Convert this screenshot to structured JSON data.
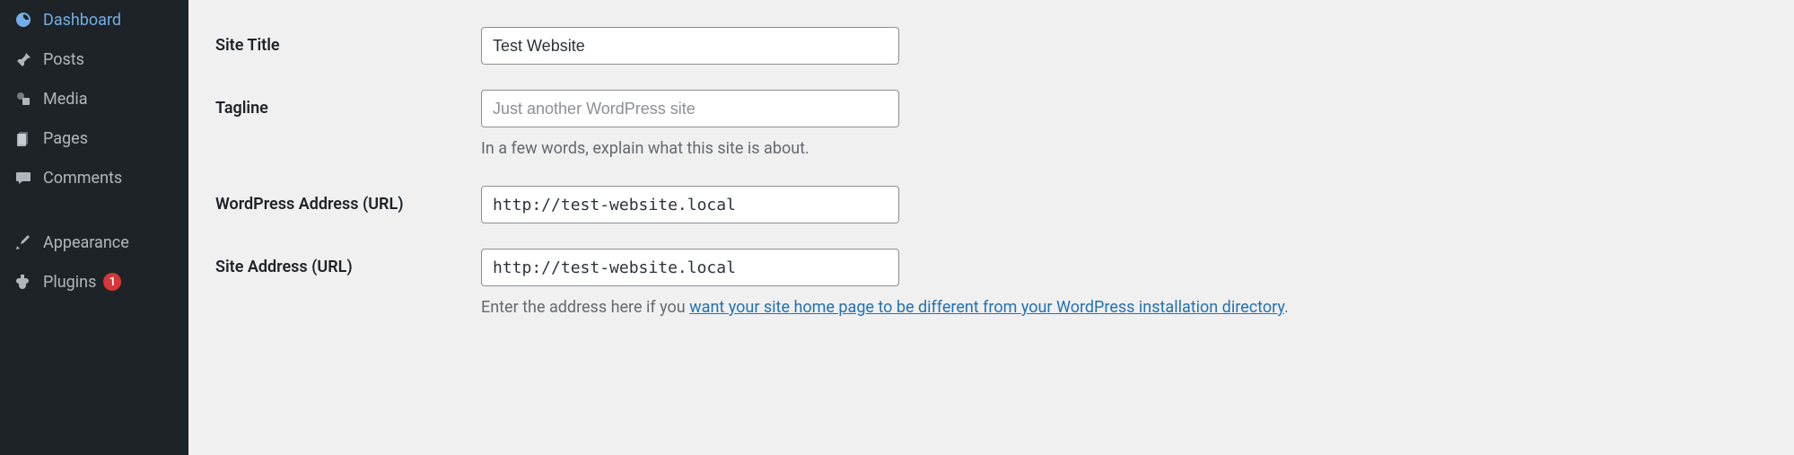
{
  "sidebar": {
    "items": [
      {
        "label": "Dashboard",
        "icon": "dashboard"
      },
      {
        "label": "Posts",
        "icon": "pin"
      },
      {
        "label": "Media",
        "icon": "media"
      },
      {
        "label": "Pages",
        "icon": "pages"
      },
      {
        "label": "Comments",
        "icon": "comments"
      },
      {
        "label": "Appearance",
        "icon": "appearance"
      },
      {
        "label": "Plugins",
        "icon": "plugins",
        "badge": "1"
      }
    ]
  },
  "form": {
    "siteTitle": {
      "label": "Site Title",
      "value": "Test Website"
    },
    "tagline": {
      "label": "Tagline",
      "placeholder": "Just another WordPress site",
      "help": "In a few words, explain what this site is about."
    },
    "wpAddress": {
      "label": "WordPress Address (URL)",
      "value": "http://test-website.local"
    },
    "siteAddress": {
      "label": "Site Address (URL)",
      "value": "http://test-website.local",
      "helpPrefix": "Enter the address here if you ",
      "helpLink": "want your site home page to be different from your WordPress installation directory",
      "helpSuffix": "."
    }
  }
}
